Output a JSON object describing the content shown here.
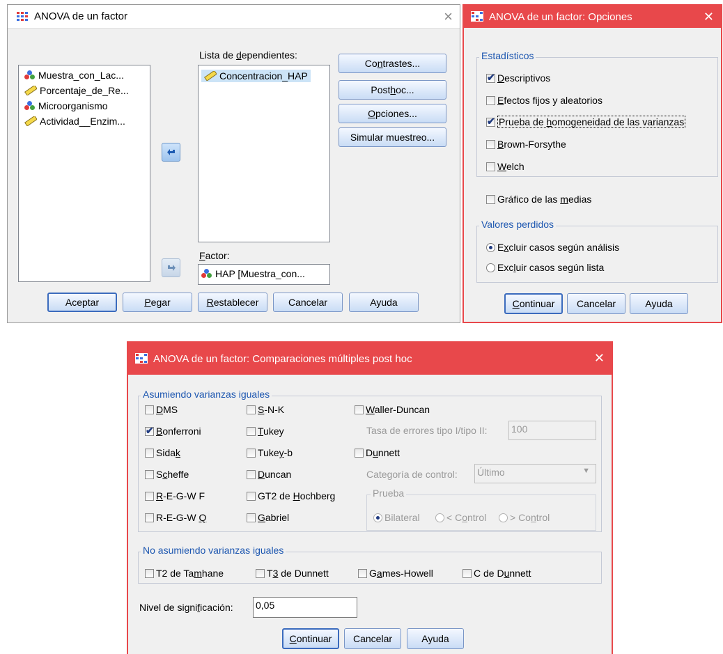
{
  "dlg1": {
    "title": "ANOVA de un factor",
    "close": "×",
    "variables": [
      {
        "label": "Muestra_con_Lac...",
        "type": "nominal"
      },
      {
        "label": "Porcentaje_de_Re...",
        "type": "scale"
      },
      {
        "label": "Microorganismo",
        "type": "nominal"
      },
      {
        "label": "Actividad__Enzim...",
        "type": "scale"
      }
    ],
    "dependents_label": "Lista de dependientes:",
    "dependents": [
      {
        "label": "Concentracion_HAP",
        "type": "scale"
      }
    ],
    "factor_label": "Factor:",
    "factor_value": "HAP [Muestra_con...",
    "side_buttons": [
      "Contrastes...",
      "Post hoc...",
      "Opciones...",
      "Simular muestreo..."
    ],
    "bottom_buttons": [
      "Aceptar",
      "Pegar",
      "Restablecer",
      "Cancelar",
      "Ayuda"
    ]
  },
  "dlg2": {
    "title": "ANOVA de un factor: Opciones",
    "close": "✕",
    "stats_group": "Estadísticos",
    "stats": [
      {
        "label": "Descriptivos",
        "checked": true
      },
      {
        "label": "Efectos fijos y aleatorios",
        "checked": false
      },
      {
        "label": "Prueba de homogeneidad de las varianzas",
        "checked": true
      },
      {
        "label": "Brown-Forsythe",
        "checked": false
      },
      {
        "label": "Welch",
        "checked": false
      }
    ],
    "plot_means": "Gráfico de las medias",
    "missing_group": "Valores perdidos",
    "missing": [
      {
        "label": "Excluir casos según análisis",
        "selected": true
      },
      {
        "label": "Excluir casos según lista",
        "selected": false
      }
    ],
    "buttons": [
      "Continuar",
      "Cancelar",
      "Ayuda"
    ]
  },
  "dlg3": {
    "title": "ANOVA de un factor: Comparaciones múltiples post hoc",
    "close": "✕",
    "equal_group": "Asumiendo varianzas iguales",
    "col1": [
      {
        "label": "DMS",
        "checked": false
      },
      {
        "label": "Bonferroni",
        "checked": true
      },
      {
        "label": "Sidak",
        "checked": false
      },
      {
        "label": "Scheffe",
        "checked": false
      },
      {
        "label": "R-E-G-W F",
        "checked": false
      },
      {
        "label": "R-E-G-W Q",
        "checked": false
      }
    ],
    "col2": [
      {
        "label": "S-N-K",
        "checked": false
      },
      {
        "label": "Tukey",
        "checked": false
      },
      {
        "label": "Tukey-b",
        "checked": false
      },
      {
        "label": "Duncan",
        "checked": false
      },
      {
        "label": "GT2 de Hochberg",
        "checked": false
      },
      {
        "label": "Gabriel",
        "checked": false
      }
    ],
    "waller": "Waller-Duncan",
    "ratio_label": "Tasa de errores tipo I/tipo II:",
    "ratio_value": "100",
    "dunnett": "Dunnett",
    "control_label": "Categoría de control:",
    "control_value": "Último",
    "test_group": "Prueba",
    "test_options": [
      {
        "label": "Bilateral",
        "selected": true
      },
      {
        "label": "< Control",
        "selected": false
      },
      {
        "label": "> Control",
        "selected": false
      }
    ],
    "unequal_group": "No asumiendo varianzas iguales",
    "unequal": [
      {
        "label": "T2 de Tamhane",
        "checked": false
      },
      {
        "label": "T3 de Dunnett",
        "checked": false
      },
      {
        "label": "Games-Howell",
        "checked": false
      },
      {
        "label": "C de Dunnett",
        "checked": false
      }
    ],
    "sig_label": "Nivel de significación:",
    "sig_value": "0,05",
    "buttons": [
      "Continuar",
      "Cancelar",
      "Ayuda"
    ]
  },
  "colors": {
    "accent_red": "#e8484b",
    "title_blue": "#1c56b0"
  }
}
